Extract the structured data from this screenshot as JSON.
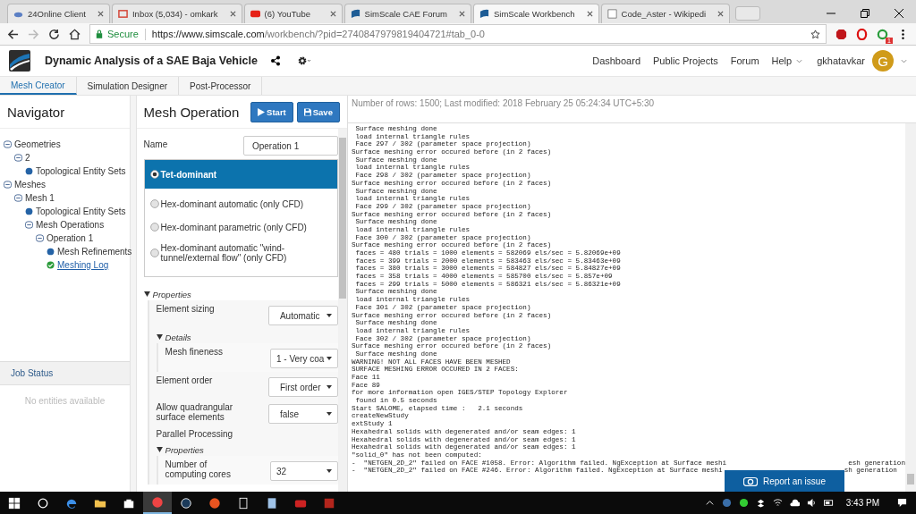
{
  "browser": {
    "tabs": [
      {
        "title": "24Online Client",
        "kind": "cloud",
        "selected": false
      },
      {
        "title": "Inbox (5,034) - omkark",
        "kind": "mail",
        "selected": false
      },
      {
        "title": "(6) YouTube",
        "kind": "play",
        "selected": false
      },
      {
        "title": "SimScale CAE Forum",
        "kind": "logo",
        "selected": false
      },
      {
        "title": "SimScale Workbench",
        "kind": "logo",
        "selected": true
      },
      {
        "title": "Code_Aster - Wikipedi",
        "kind": "wiki",
        "selected": false
      }
    ],
    "secure_label": "Secure",
    "url_host": "https://www.simscale.com",
    "url_path": "/workbench/?pid=2740847979819404721#tab_0-0",
    "extension_badge": "1"
  },
  "header": {
    "title": "Dynamic Analysis of a SAE Baja Vehicle",
    "nav": [
      "Dashboard",
      "Public Projects",
      "Forum",
      "Help"
    ],
    "user": "gkhatavkar",
    "avatar": "G"
  },
  "app_tabs": [
    {
      "label": "Mesh Creator",
      "selected": true
    },
    {
      "label": "Simulation Designer",
      "selected": false
    },
    {
      "label": "Post-Processor",
      "selected": false
    }
  ],
  "navigator": {
    "title": "Navigator",
    "tree": [
      {
        "label": "Geometries",
        "kind": "group",
        "expanded": true,
        "children": [
          {
            "label": "2",
            "kind": "group",
            "expanded": true,
            "children": [
              {
                "label": "Topological Entity Sets",
                "kind": "item"
              }
            ]
          }
        ]
      },
      {
        "label": "Meshes",
        "kind": "group",
        "expanded": true,
        "children": [
          {
            "label": "Mesh 1",
            "kind": "group",
            "expanded": true,
            "children": [
              {
                "label": "Topological Entity Sets",
                "kind": "item"
              },
              {
                "label": "Mesh Operations",
                "kind": "group",
                "expanded": true,
                "children": [
                  {
                    "label": "Operation 1",
                    "kind": "group",
                    "expanded": true,
                    "children": [
                      {
                        "label": "Mesh Refinements",
                        "kind": "item"
                      },
                      {
                        "label": "Meshing Log",
                        "kind": "done"
                      }
                    ]
                  }
                ]
              }
            ]
          }
        ]
      }
    ]
  },
  "job_status": {
    "title": "Job Status",
    "empty": "No entities available"
  },
  "mesh_operation": {
    "title": "Mesh Operation",
    "buttons": [
      {
        "label": "Start",
        "kind": "play"
      },
      {
        "label": "Save",
        "kind": "save"
      }
    ],
    "name_label": "Name",
    "name_value": "Operation 1",
    "options": [
      {
        "label": "Tet-dominant",
        "selected": true
      },
      {
        "label": "Hex-dominant automatic (only CFD)",
        "selected": false
      },
      {
        "label": "Hex-dominant parametric (only CFD)",
        "selected": false
      },
      {
        "label": "Hex-dominant automatic \"wind-tunnel/external flow\" (only CFD)",
        "selected": false
      }
    ],
    "properties": {
      "title": "Properties",
      "rows": [
        {
          "kind": "select",
          "label": "Element sizing",
          "value": "Automatic"
        },
        {
          "kind": "section",
          "title": "Details",
          "rows": [
            {
              "kind": "select",
              "label": "Mesh fineness",
              "value": "1 - Very coa"
            }
          ]
        },
        {
          "kind": "select",
          "label": "Element order",
          "value": "First order"
        },
        {
          "kind": "select",
          "label": "Allow quadrangular surface elements",
          "value": "false"
        },
        {
          "kind": "label",
          "label": "Parallel Processing"
        },
        {
          "kind": "section",
          "title": "Properties",
          "rows": [
            {
              "kind": "select",
              "label": "Number of computing cores",
              "value": "32"
            }
          ]
        }
      ]
    }
  },
  "log": {
    "summary": "Number of rows: 1500; Last modified: 2018 February 25 05:24:34 UTC+5:30",
    "lines": [
      {
        "text": " Surface meshing done"
      },
      {
        "text": " load internal triangle rules"
      },
      {
        "text": " Face 297 / 302 (parameter space projection)"
      },
      {
        "text": "Surface meshing error occured before (in 2 faces)"
      },
      {
        "text": " Surface meshing done"
      },
      {
        "text": " load internal triangle rules"
      },
      {
        "text": " Face 298 / 302 (parameter space projection)"
      },
      {
        "text": "Surface meshing error occured before (in 2 faces)"
      },
      {
        "text": " Surface meshing done"
      },
      {
        "text": " load internal triangle rules"
      },
      {
        "text": " Face 299 / 302 (parameter space projection)"
      },
      {
        "text": "Surface meshing error occured before (in 2 faces)"
      },
      {
        "text": " Surface meshing done"
      },
      {
        "text": " load internal triangle rules"
      },
      {
        "text": " Face 300 / 302 (parameter space projection)"
      },
      {
        "text": "Surface meshing error occured before (in 2 faces)"
      },
      {
        "text": " faces = 480 trials = 1000 elements = 582069 els/sec = 5.82069e+09"
      },
      {
        "text": " faces = 399 trials = 2000 elements = 583463 els/sec = 5.83463e+09"
      },
      {
        "text": " faces = 380 trials = 3000 elements = 584827 els/sec = 5.84827e+09"
      },
      {
        "text": " faces = 358 trials = 4000 elements = 585700 els/sec = 5.857e+09"
      },
      {
        "text": " faces = 299 trials = 5000 elements = 586321 els/sec = 5.86321e+09"
      },
      {
        "text": " Surface meshing done"
      },
      {
        "text": " load internal triangle rules"
      },
      {
        "text": " Face 301 / 302 (parameter space projection)"
      },
      {
        "text": "Surface meshing error occured before (in 2 faces)"
      },
      {
        "text": " Surface meshing done"
      },
      {
        "text": " load internal triangle rules"
      },
      {
        "text": " Face 302 / 302 (parameter space projection)"
      },
      {
        "text": "Surface meshing error occured before (in 2 faces)"
      },
      {
        "text": " Surface meshing done"
      },
      {
        "text": "WARNING! NOT ALL FACES HAVE BEEN MESHED"
      },
      {
        "text": "SURFACE MESHING ERROR OCCURED IN 2 FACES:"
      },
      {
        "text": "Face 11"
      },
      {
        "text": "Face 89"
      },
      {
        "text": "for more information open IGES/STEP Topology Explorer"
      },
      {
        "text": " found in 0.5 seconds"
      },
      {
        "text": "Start SALOME, elapsed time :   2.1 seconds"
      },
      {
        "text": "createNewStudy"
      },
      {
        "text": "extStudy 1"
      },
      {
        "text": "Hexahedral solids with degenerated and/or seam edges: 1"
      },
      {
        "text": "Hexahedral solids with degenerated and/or seam edges: 1"
      },
      {
        "text": "Hexahedral solids with degenerated and/or seam edges: 1"
      },
      {
        "text": "\"solid_0\" has not been computed:"
      },
      {
        "text": "-  \"NETGEN_2D_2\" failed on FACE #1058. Error: Algorithm failed. NgException at Surface meshi",
        "tail": "esh generation"
      },
      {
        "text": "-  \"NETGEN_2D_2\" failed on FACE #246. Error: Algorithm failed. NgException at Surface meshi",
        "tail": "sh generation"
      }
    ],
    "report_button": "Report an issue"
  },
  "taskbar": {
    "time": "3:43 PM"
  }
}
